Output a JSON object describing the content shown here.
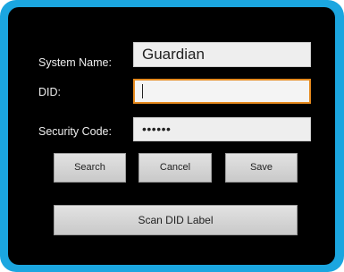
{
  "form": {
    "system_name_label": "System Name:",
    "system_name_value": "Guardian",
    "did_label": "DID:",
    "did_value": "",
    "security_code_label": "Security Code:",
    "security_code_value": "••••••"
  },
  "buttons": {
    "search": "Search",
    "cancel": "Cancel",
    "save": "Save",
    "scan": "Scan DID Label"
  },
  "colors": {
    "frame": "#1ba6e0",
    "screen": "#000000",
    "focus_border": "#e68a1e"
  }
}
